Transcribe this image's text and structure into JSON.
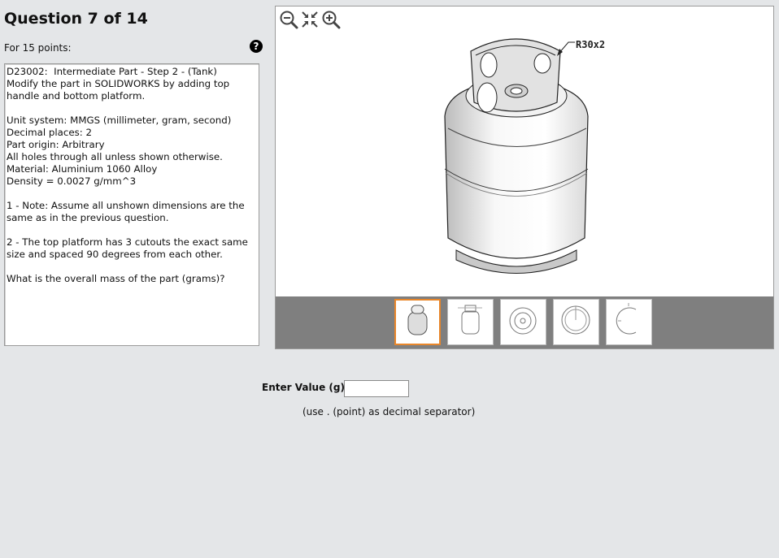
{
  "header": {
    "title": "Question 7 of 14",
    "points": "For 15 points:",
    "help_glyph": "?"
  },
  "question": {
    "text": "D23002:  Intermediate Part - Step 2 - (Tank)\nModify the part in SOLIDWORKS by adding top handle and bottom platform.\n\nUnit system: MMGS (millimeter, gram, second)\nDecimal places: 2\nPart origin: Arbitrary\nAll holes through all unless shown otherwise.\nMaterial: Aluminium 1060 Alloy\nDensity = 0.0027 g/mm^3\n\n1 - Note: Assume all unshown dimensions are the same as in the previous question.\n\n2 - The top platform has 3 cutouts the exact same size and spaced 90 degrees from each other.\n\nWhat is the overall mass of the part (grams)?"
  },
  "viewer": {
    "toolbar": [
      "zoom-out-icon",
      "fit-view-icon",
      "zoom-in-icon"
    ],
    "dimension_label": "R30x2",
    "thumbnails": [
      "thumb-1",
      "thumb-2",
      "thumb-3",
      "thumb-4",
      "thumb-5"
    ],
    "active_thumbnail": 0,
    "accent_color": "#e8862a"
  },
  "answer": {
    "label": "Enter Value (g):",
    "value": "",
    "placeholder": "",
    "hint": "(use . (point) as decimal separator)"
  }
}
